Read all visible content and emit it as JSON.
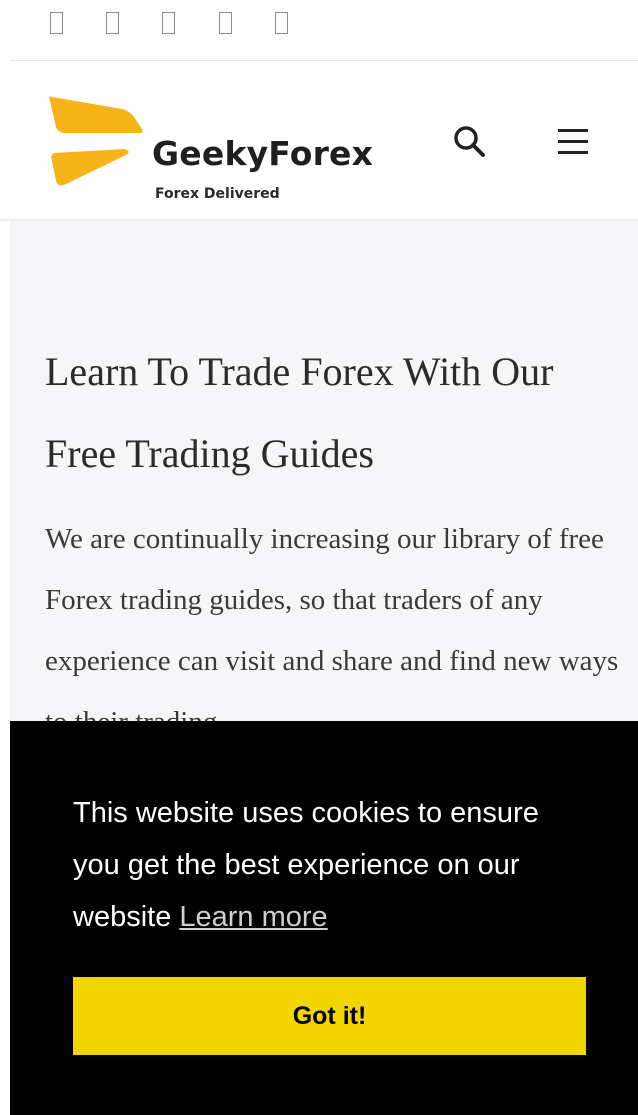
{
  "topbar": {
    "icons": [
      "social-icon",
      "social-icon",
      "social-icon",
      "social-icon",
      "social-icon"
    ]
  },
  "header": {
    "logo_name": "GeekyForex",
    "logo_tagline": "Forex Delivered",
    "logo_color": "#f7b418",
    "search_icon": "search-icon",
    "menu_icon": "hamburger-menu-icon"
  },
  "hero": {
    "title": "Learn To Trade Forex With Our Free Trading Guides",
    "text": "We are continually increasing our library of free Forex trading guides, so that traders of any experience can visit and share and find new ways to their trading"
  },
  "cookie_banner": {
    "message": "This website uses cookies to ensure you get the best experience on our website",
    "learn_more": "Learn more",
    "accept_label": "Got it!",
    "accent_color": "#f1d600",
    "background": "#000000"
  }
}
